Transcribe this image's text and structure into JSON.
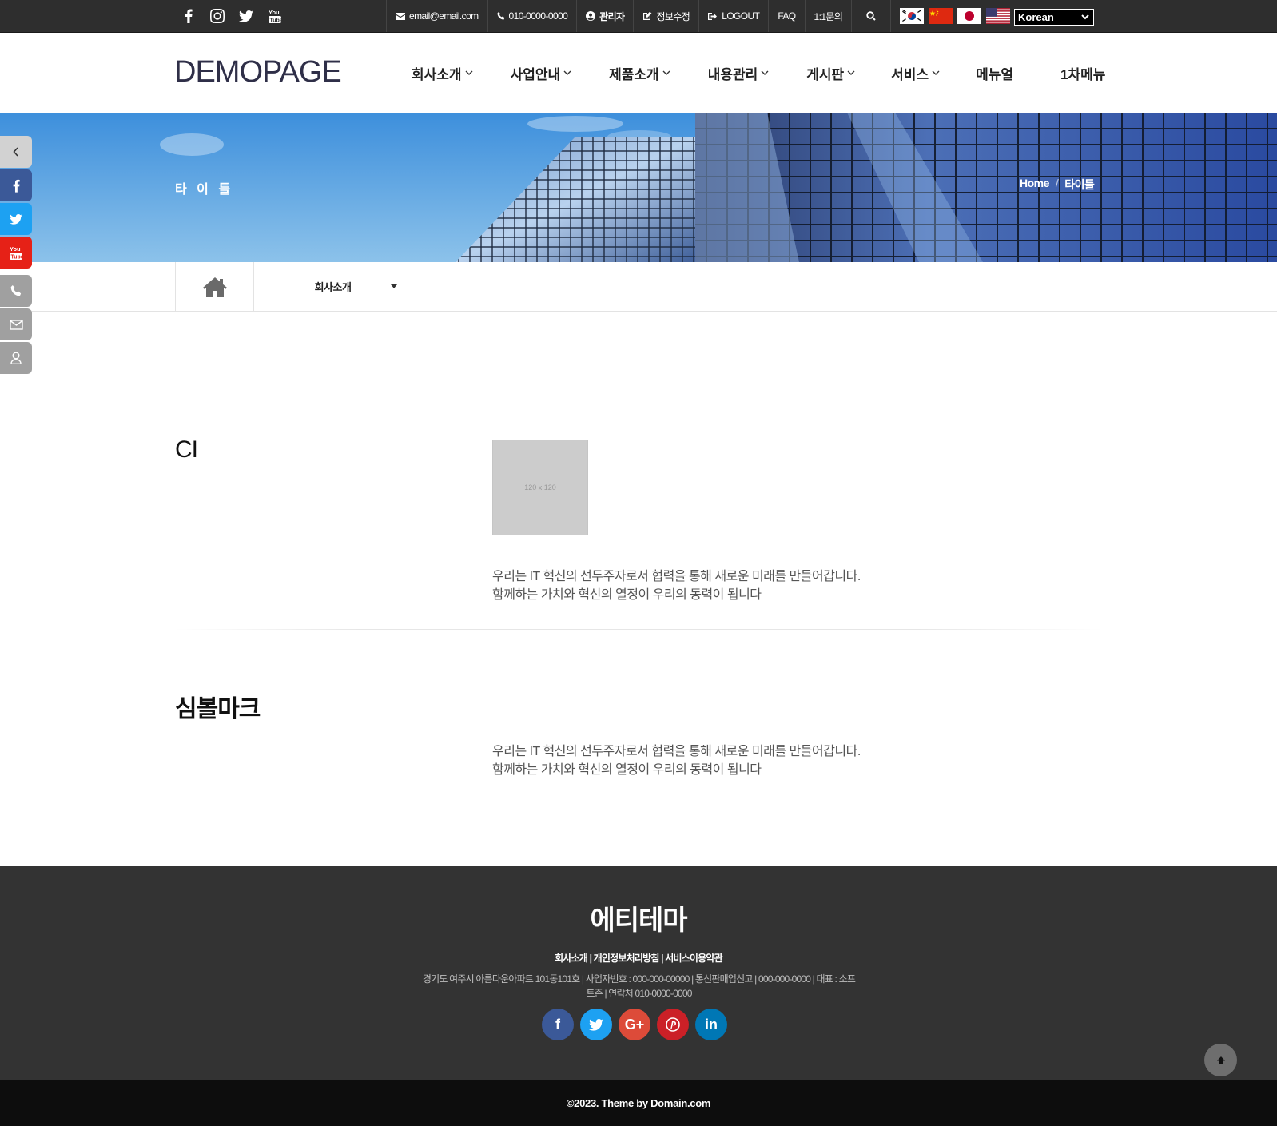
{
  "topbar": {
    "social": [
      {
        "icon": "facebook-icon"
      },
      {
        "icon": "instagram-icon"
      },
      {
        "icon": "twitter-icon"
      },
      {
        "icon": "youtube-icon"
      }
    ],
    "email": "email@email.com",
    "phone": "010-0000-0000",
    "admin": "관리자",
    "edit_info": "정보수정",
    "logout": "LOGOUT",
    "faq": "FAQ",
    "inquiry": "1:1문의",
    "languages": [
      "korea-flag-icon",
      "china-flag-icon",
      "japan-flag-icon",
      "usa-flag-icon"
    ],
    "language_selected": "Korean"
  },
  "header": {
    "logo": "DEMOPAGE",
    "menu": [
      {
        "label": "회사소개",
        "has_sub": true
      },
      {
        "label": "사업안내",
        "has_sub": true
      },
      {
        "label": "제품소개",
        "has_sub": true
      },
      {
        "label": "내용관리",
        "has_sub": true
      },
      {
        "label": "게시판",
        "has_sub": true
      },
      {
        "label": "서비스",
        "has_sub": true
      },
      {
        "label": "메뉴얼",
        "has_sub": false
      },
      {
        "label": "1차메뉴",
        "has_sub": false
      }
    ]
  },
  "banner": {
    "title": "타 이 틀",
    "breadcrumb_home": "Home",
    "breadcrumb_sep": "/",
    "breadcrumb_current": "타이틀"
  },
  "subnav": {
    "dropdown_label": "회사소개"
  },
  "content": {
    "ci_title": "CI",
    "ci_placeholder": "120 x 120",
    "ci_text_1": "우리는 IT 혁신의 선두주자로서 협력을 통해 새로운 미래를 만들어갑니다.",
    "ci_text_2": "함께하는 가치와 혁신의 열정이 우리의 동력이 됩니다",
    "symbol_title": "심볼마크",
    "symbol_text_1": "우리는 IT 혁신의 선두주자로서 협력을 통해 새로운 미래를 만들어갑니다.",
    "symbol_text_2": "함께하는 가치와 혁신의 열정이 우리의 동력이 됩니다"
  },
  "footer": {
    "title": "에티테마",
    "links": "회사소개 | 개인정보처리방침 | 서비스이용약관",
    "address_1": "경기도 여주시 아름다운아파트 101동101호 | 사업자번호 : 000-000-00000 | 통신판매업신고 | 000-000-0000 | 대표 : 소프",
    "address_2": "트존 | 연락처 010-0000-0000",
    "social_glyphs": {
      "facebook": "f",
      "google": "G+",
      "linkedin": "in"
    },
    "copyright": "©2023. Theme by Domain.com"
  },
  "colors": {
    "topbar_bg": "#2e2e2e",
    "footer_bg": "#333333",
    "copyright_bg": "#0d0d0d",
    "facebook": "#3b5998",
    "twitter": "#1da1f2",
    "youtube": "#e62117",
    "google": "#dd4b39",
    "pinterest": "#cb2027",
    "linkedin": "#0077b5"
  }
}
